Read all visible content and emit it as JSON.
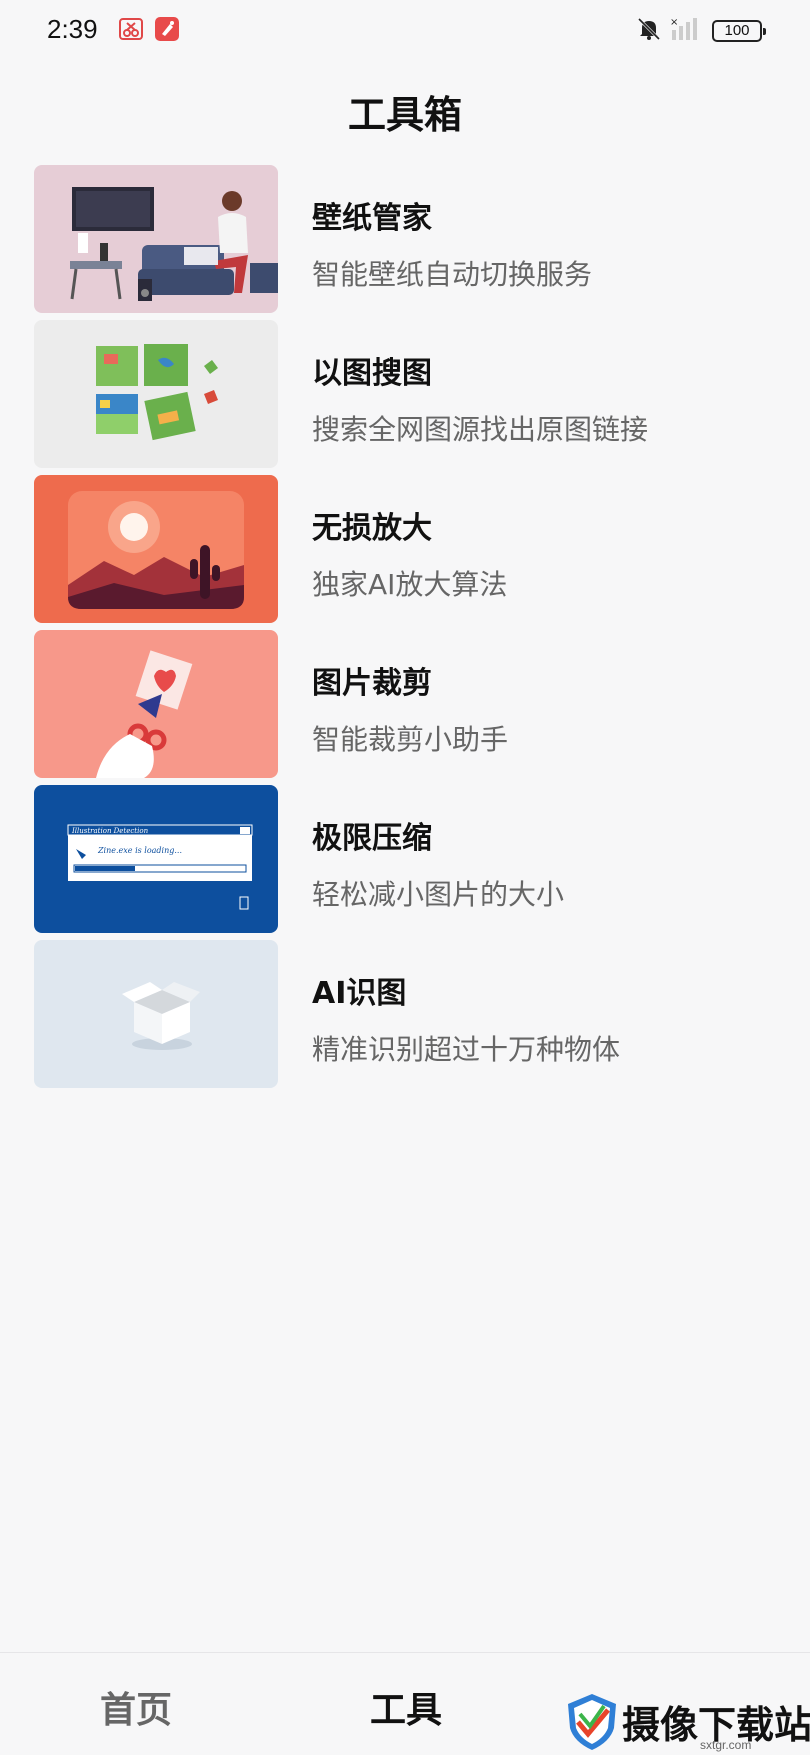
{
  "status": {
    "time": "2:39",
    "battery": "100"
  },
  "page": {
    "title": "工具箱"
  },
  "tools": [
    {
      "name": "壁纸管家",
      "desc": "智能壁纸自动切换服务",
      "thumb_bg": "#e6cdd6"
    },
    {
      "name": "以图搜图",
      "desc": "搜索全网图源找出原图链接",
      "thumb_bg": "#ececec"
    },
    {
      "name": "无损放大",
      "desc": "独家AI放大算法",
      "thumb_bg": "#ee6b4d"
    },
    {
      "name": "图片裁剪",
      "desc": "智能裁剪小助手",
      "thumb_bg": "#f7988a"
    },
    {
      "name": "极限压缩",
      "desc": "轻松减小图片的大小",
      "thumb_bg": "#0d4f9e"
    },
    {
      "name": "AI识图",
      "desc": "精准识别超过十万种物体",
      "thumb_bg": "#dfe7ef"
    }
  ],
  "thumb_texts": {
    "compress_window_title": "Illustration Detection",
    "compress_loading": "Zine.exe is loading..."
  },
  "nav": {
    "home": "首页",
    "tools": "工具"
  },
  "watermark": {
    "text": "摄像下载站",
    "url": "sxtgr.com"
  }
}
